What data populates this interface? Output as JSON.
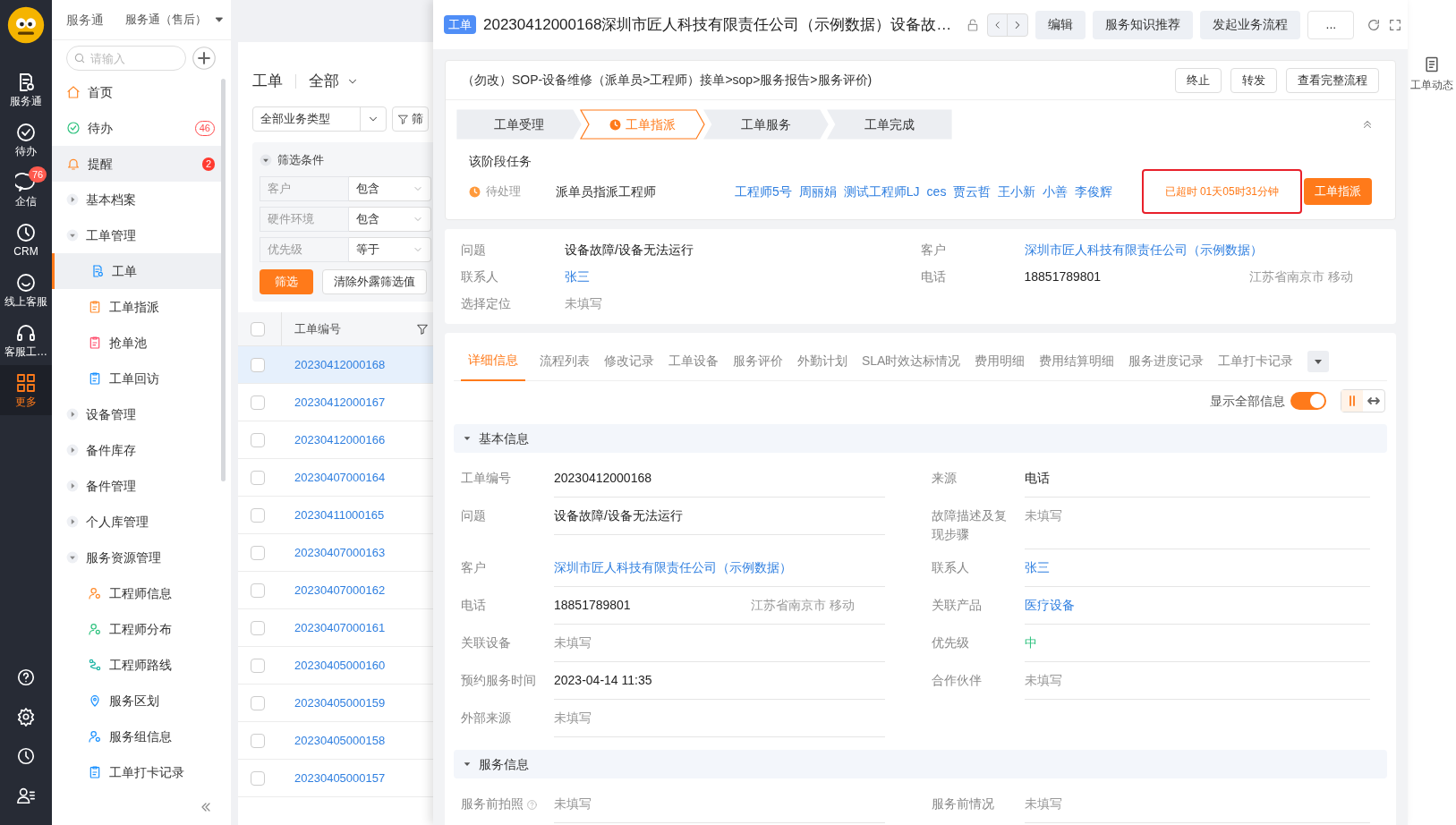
{
  "rail": {
    "items": [
      {
        "label": "服务通",
        "selected": false
      },
      {
        "label": "待办",
        "selected": false
      },
      {
        "label": "企信",
        "badge": "76",
        "selected": false
      },
      {
        "label": "CRM",
        "selected": false
      },
      {
        "label": "线上客服",
        "selected": false
      },
      {
        "label": "客服工…",
        "selected": false
      },
      {
        "label": "更多",
        "selected": true
      }
    ]
  },
  "app_header": {
    "product": "服务通",
    "switcher": "服务通（售后）"
  },
  "nav_search": {
    "placeholder": "请输入"
  },
  "nav": [
    {
      "kind": "page",
      "label": "首页",
      "selected": false,
      "hovered": false
    },
    {
      "kind": "page",
      "label": "待办",
      "badge": {
        "text": "46",
        "kind": "outline"
      },
      "selected": false,
      "hovered": false
    },
    {
      "kind": "page",
      "label": "提醒",
      "badge": {
        "text": "2",
        "kind": "filled"
      },
      "selected": false,
      "hovered": true
    },
    {
      "kind": "group",
      "label": "基本档案",
      "expanded": false
    },
    {
      "kind": "group",
      "label": "工单管理",
      "expanded": true,
      "children": [
        {
          "label": "工单",
          "selected": true
        },
        {
          "label": "工单指派",
          "selected": false
        },
        {
          "label": "抢单池",
          "selected": false
        },
        {
          "label": "工单回访",
          "selected": false
        }
      ]
    },
    {
      "kind": "group",
      "label": "设备管理",
      "expanded": false
    },
    {
      "kind": "group",
      "label": "备件库存",
      "expanded": false
    },
    {
      "kind": "group",
      "label": "备件管理",
      "expanded": false
    },
    {
      "kind": "group",
      "label": "个人库管理",
      "expanded": false
    },
    {
      "kind": "group",
      "label": "服务资源管理",
      "expanded": true,
      "children": [
        {
          "label": "工程师信息",
          "selected": false
        },
        {
          "label": "工程师分布",
          "selected": false
        },
        {
          "label": "工程师路线",
          "selected": false
        },
        {
          "label": "服务区划",
          "selected": false
        },
        {
          "label": "服务组信息",
          "selected": false
        },
        {
          "label": "工单打卡记录",
          "selected": false
        }
      ]
    }
  ],
  "list": {
    "title": "工单",
    "scope": "全部",
    "type_filter": "全部业务类型",
    "filter_button": "筛",
    "filter_section": {
      "title": "筛选条件",
      "expanded": true,
      "rows": [
        {
          "field": "客户",
          "operator": "包含"
        },
        {
          "field": "硬件环境",
          "operator": "包含"
        },
        {
          "field": "优先级",
          "operator": "等于"
        }
      ]
    },
    "apply": "筛选",
    "clear": "清除外露筛选值",
    "column": "工单编号",
    "all_checked": false,
    "rows": [
      {
        "id": "20230412000168",
        "selected": true,
        "checked": false
      },
      {
        "id": "20230412000167",
        "selected": false,
        "checked": false
      },
      {
        "id": "20230412000166",
        "selected": false,
        "checked": false
      },
      {
        "id": "20230407000164",
        "selected": false,
        "checked": false
      },
      {
        "id": "20230411000165",
        "selected": false,
        "checked": false
      },
      {
        "id": "20230407000163",
        "selected": false,
        "checked": false
      },
      {
        "id": "20230407000162",
        "selected": false,
        "checked": false
      },
      {
        "id": "20230407000161",
        "selected": false,
        "checked": false
      },
      {
        "id": "20230405000160",
        "selected": false,
        "checked": false
      },
      {
        "id": "20230405000159",
        "selected": false,
        "checked": false
      },
      {
        "id": "20230405000158",
        "selected": false,
        "checked": false
      },
      {
        "id": "20230405000157",
        "selected": false,
        "checked": false
      }
    ]
  },
  "detail": {
    "tag": "工单",
    "title": "20230412000168深圳市匠人科技有限责任公司（示例数据）设备故…",
    "actions": [
      "编辑",
      "服务知识推荐",
      "发起业务流程",
      "..."
    ]
  },
  "process": {
    "name": "（勿改）SOP-设备维修（派单员>工程师）接单>sop>服务报告>服务评价)",
    "buttons": [
      "终止",
      "转发",
      "查看完整流程"
    ],
    "steps": [
      {
        "label": "工单受理",
        "selected": false
      },
      {
        "label": "工单指派",
        "selected": true
      },
      {
        "label": "工单服务",
        "selected": false
      },
      {
        "label": "工单完成",
        "selected": false
      }
    ],
    "stage_title": "该阶段任务",
    "task": {
      "status": "待处理",
      "name": "派单员指派工程师",
      "assignees": [
        "工程师5号",
        "周丽娟",
        "测试工程师LJ",
        "ces",
        "贾云哲",
        "王小新",
        "小善",
        "李俊辉"
      ],
      "overdue": "已超时 01天05时31分钟",
      "highlighted": true,
      "action": "工单指派"
    }
  },
  "summary_rows": [
    [
      {
        "label": "问题",
        "value": "设备故障/设备无法运行",
        "kind": "text"
      },
      {
        "label": "客户",
        "value": "深圳市匠人科技有限责任公司（示例数据）",
        "kind": "link"
      }
    ],
    [
      {
        "label": "联系人",
        "value": "张三",
        "kind": "link"
      },
      {
        "label": "电话",
        "value": "18851789801",
        "kind": "text",
        "note": "江苏省南京市 移动"
      }
    ],
    [
      {
        "label": "选择定位",
        "value": "未填写",
        "kind": "empty"
      }
    ]
  ],
  "tabs": [
    {
      "label": "详细信息",
      "selected": true
    },
    {
      "label": "流程列表",
      "selected": false
    },
    {
      "label": "修改记录",
      "selected": false
    },
    {
      "label": "工单设备",
      "selected": false
    },
    {
      "label": "服务评价",
      "selected": false
    },
    {
      "label": "外勤计划",
      "selected": false
    },
    {
      "label": "SLA时效达标情况",
      "selected": false
    },
    {
      "label": "费用明细",
      "selected": false
    },
    {
      "label": "费用结算明细",
      "selected": false
    },
    {
      "label": "服务进度记录",
      "selected": false
    },
    {
      "label": "工单打卡记录",
      "selected": false
    }
  ],
  "show_all": {
    "label": "显示全部信息",
    "on": true
  },
  "sections": [
    {
      "title": "基本信息",
      "expanded": true,
      "rows": [
        [
          {
            "label": "工单编号",
            "value": "20230412000168",
            "kind": "text"
          },
          {
            "label": "来源",
            "value": "电话",
            "kind": "text"
          }
        ],
        [
          {
            "label": "问题",
            "value": "设备故障/设备无法运行",
            "kind": "text"
          },
          {
            "label": "故障描述及复现步骤",
            "value": "未填写",
            "kind": "empty"
          }
        ],
        [
          {
            "label": "客户",
            "value": "深圳市匠人科技有限责任公司（示例数据）",
            "kind": "link"
          },
          {
            "label": "联系人",
            "value": "张三",
            "kind": "link"
          }
        ],
        [
          {
            "label": "电话",
            "value": "18851789801",
            "kind": "text",
            "note": "江苏省南京市 移动"
          },
          {
            "label": "关联产品",
            "value": "医疗设备",
            "kind": "link"
          }
        ],
        [
          {
            "label": "关联设备",
            "value": "未填写",
            "kind": "empty"
          },
          {
            "label": "优先级",
            "value": "中",
            "kind": "priority"
          }
        ],
        [
          {
            "label": "预约服务时间",
            "value": "2023-04-14 11:35",
            "kind": "text"
          },
          {
            "label": "合作伙伴",
            "value": "未填写",
            "kind": "empty"
          }
        ],
        [
          {
            "label": "外部来源",
            "value": "未填写",
            "kind": "empty"
          }
        ]
      ]
    },
    {
      "title": "服务信息",
      "expanded": true,
      "rows": [
        [
          {
            "label": "服务前拍照",
            "value": "未填写",
            "kind": "empty",
            "help": true
          },
          {
            "label": "服务前情况",
            "value": "未填写",
            "kind": "empty"
          }
        ]
      ]
    }
  ],
  "right_rail": {
    "label": "工单动态"
  }
}
